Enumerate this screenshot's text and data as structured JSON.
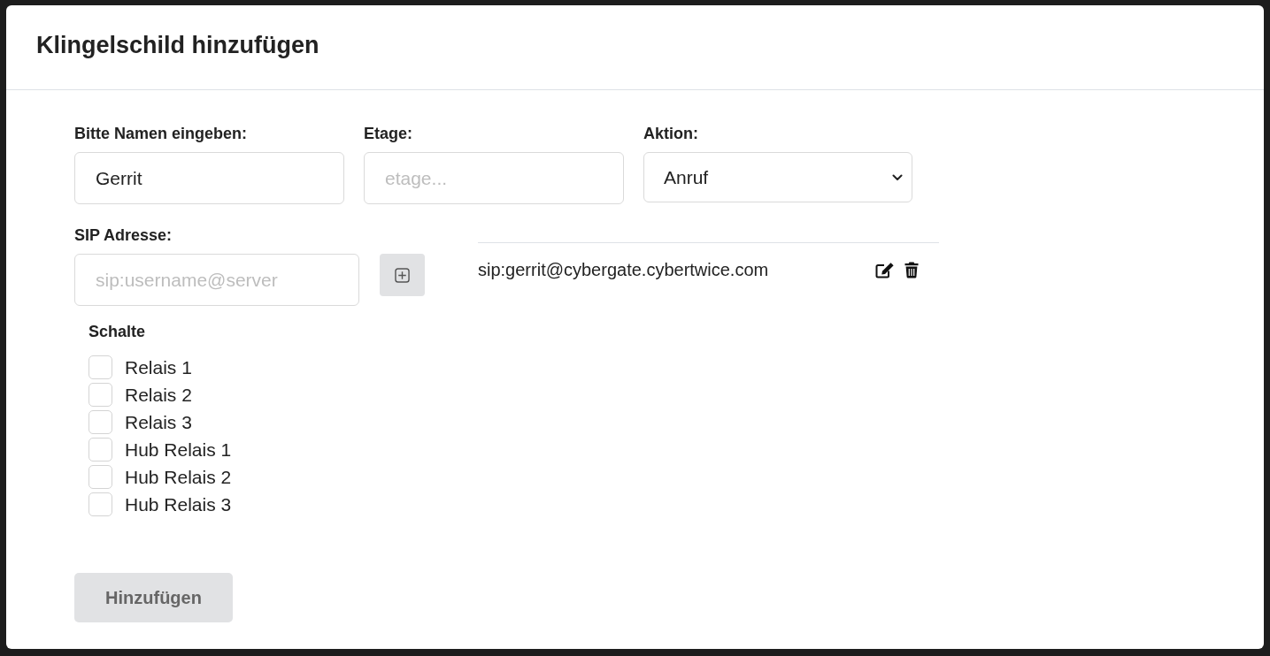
{
  "dialog": {
    "title": "Klingelschild hinzufügen"
  },
  "fields": [
    {
      "kind": "text",
      "label": "Bitte Namen eingeben:",
      "value": "Gerrit"
    },
    {
      "kind": "text",
      "label": "Etage:",
      "placeholder": "etage..."
    },
    {
      "kind": "select",
      "label": "Aktion:",
      "value": "Anruf"
    }
  ],
  "sip": {
    "label": "SIP Adresse:",
    "placeholder": "sip:username@server",
    "add_button": {
      "disabled": true
    },
    "addresses": [
      "sip:gerrit@cybergate.cybertwice.com"
    ]
  },
  "switches": {
    "title": "Schalte",
    "items": [
      {
        "label": "Relais 1",
        "checked": false
      },
      {
        "label": "Relais 2",
        "checked": false
      },
      {
        "label": "Relais 3",
        "checked": false
      },
      {
        "label": "Hub Relais 1",
        "checked": false
      },
      {
        "label": "Hub Relais 2",
        "checked": false
      },
      {
        "label": "Hub Relais 3",
        "checked": false
      }
    ]
  },
  "submit": {
    "label": "Hinzufügen",
    "disabled": true
  }
}
